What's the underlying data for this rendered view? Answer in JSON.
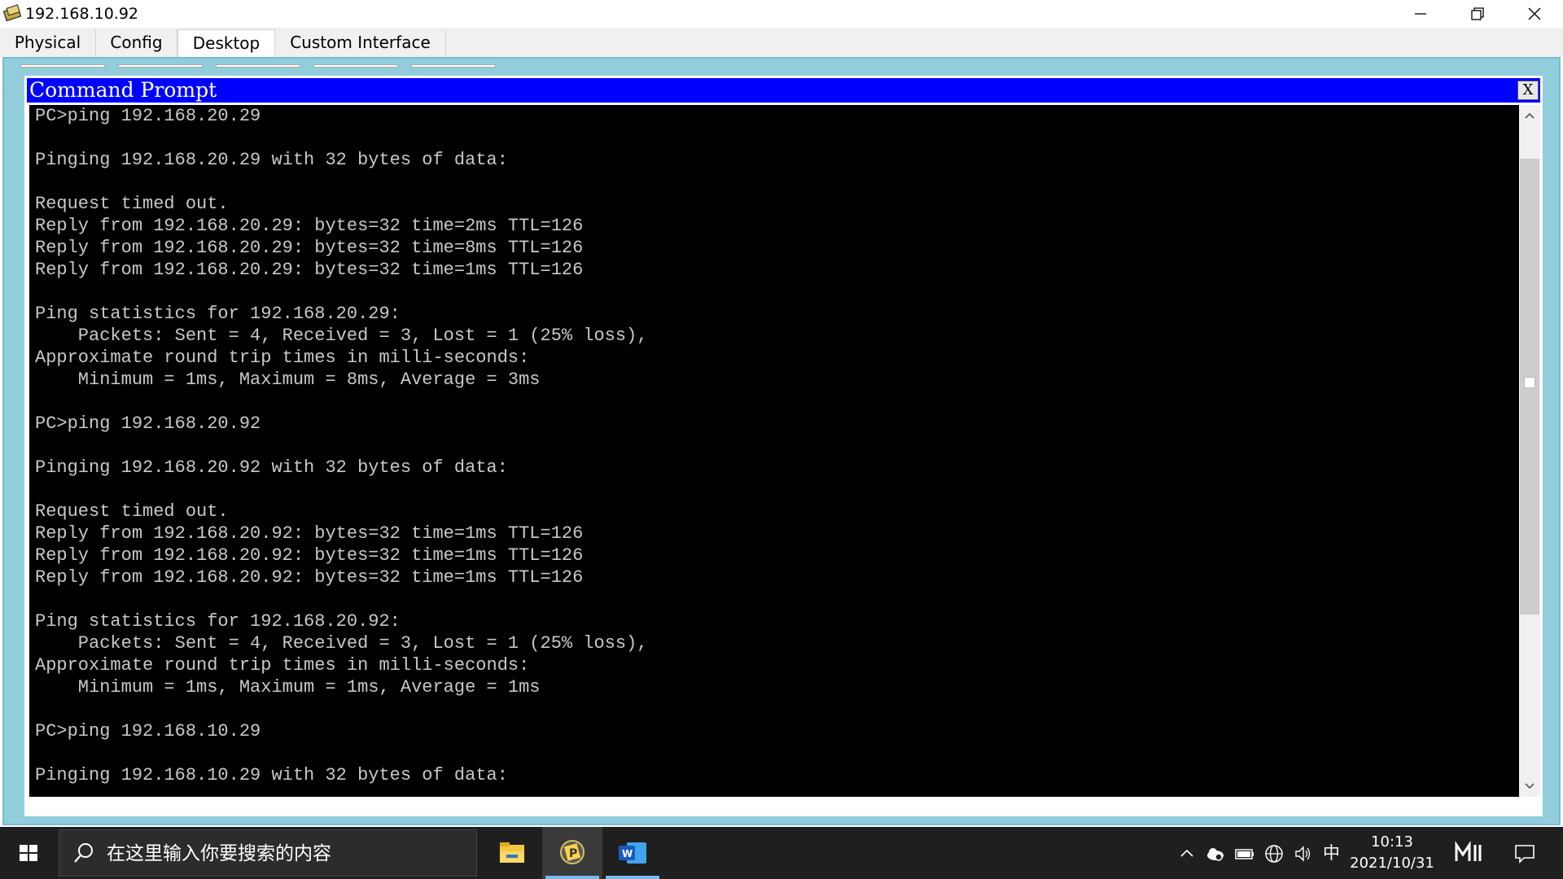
{
  "window": {
    "title": "192.168.10.92"
  },
  "tabs": [
    {
      "label": "Physical"
    },
    {
      "label": "Config"
    },
    {
      "label": "Desktop"
    },
    {
      "label": "Custom Interface"
    }
  ],
  "cmd": {
    "title": "Command Prompt",
    "close_label": "X",
    "lines": [
      "PC>ping 192.168.20.29",
      "",
      "Pinging 192.168.20.29 with 32 bytes of data:",
      "",
      "Request timed out.",
      "Reply from 192.168.20.29: bytes=32 time=2ms TTL=126",
      "Reply from 192.168.20.29: bytes=32 time=8ms TTL=126",
      "Reply from 192.168.20.29: bytes=32 time=1ms TTL=126",
      "",
      "Ping statistics for 192.168.20.29:",
      "    Packets: Sent = 4, Received = 3, Lost = 1 (25% loss),",
      "Approximate round trip times in milli-seconds:",
      "    Minimum = 1ms, Maximum = 8ms, Average = 3ms",
      "",
      "PC>ping 192.168.20.92",
      "",
      "Pinging 192.168.20.92 with 32 bytes of data:",
      "",
      "Request timed out.",
      "Reply from 192.168.20.92: bytes=32 time=1ms TTL=126",
      "Reply from 192.168.20.92: bytes=32 time=1ms TTL=126",
      "Reply from 192.168.20.92: bytes=32 time=1ms TTL=126",
      "",
      "Ping statistics for 192.168.20.92:",
      "    Packets: Sent = 4, Received = 3, Lost = 1 (25% loss),",
      "Approximate round trip times in milli-seconds:",
      "    Minimum = 1ms, Maximum = 1ms, Average = 1ms",
      "",
      "PC>ping 192.168.10.29",
      "",
      "Pinging 192.168.10.29 with 32 bytes of data:"
    ]
  },
  "taskbar": {
    "search_placeholder": "在这里输入你要搜索的内容",
    "ime_label": "中",
    "time": "10:13",
    "date": "2021/10/31"
  },
  "colors": {
    "cmd_title_bg": "#0000ff",
    "cmd_body_bg": "#000000",
    "cmd_text": "#c8c8c8",
    "desktop_panel": "#92cddc",
    "taskbar_bg": "#1f1f1f",
    "taskbar_accent": "#76b9ed"
  },
  "icons": {
    "app": "packet-tracer-icon",
    "minimize": "minimize-icon",
    "maximize": "restore-icon",
    "close": "close-icon",
    "start": "windows-start-icon",
    "search": "search-icon",
    "explorer": "file-explorer-icon",
    "packet_tracer": "packet-tracer-icon",
    "word": "word-icon"
  }
}
